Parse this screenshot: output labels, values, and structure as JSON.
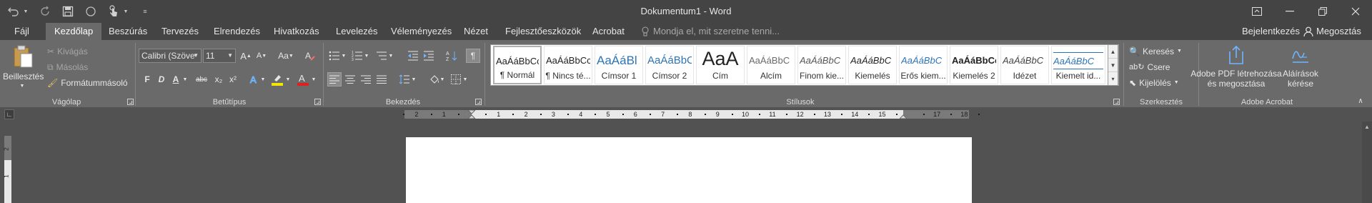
{
  "window": {
    "title": "Dokumentum1 - Word"
  },
  "quick_access": {
    "undo_icon": "undo-icon",
    "redo_icon": "redo-icon",
    "save_icon": "save-icon",
    "circle_icon": "circle-icon",
    "touch_icon": "touch-mode-icon",
    "customize_icon": "customize-qat-icon"
  },
  "tabs": [
    {
      "label": "Fájl"
    },
    {
      "label": "Kezdőlap"
    },
    {
      "label": "Beszúrás"
    },
    {
      "label": "Tervezés"
    },
    {
      "label": "Elrendezés"
    },
    {
      "label": "Hivatkozás"
    },
    {
      "label": "Levelezés"
    },
    {
      "label": "Véleményezés"
    },
    {
      "label": "Nézet"
    },
    {
      "label": "Fejlesztőeszközök"
    },
    {
      "label": "Acrobat"
    }
  ],
  "tell_me": "Mondja el, mit szeretne tenni...",
  "account": {
    "signin": "Bejelentkezés",
    "share": "Megosztás"
  },
  "clipboard": {
    "paste": "Beillesztés",
    "cut": "Kivágás",
    "copy": "Másolás",
    "format_painter": "Formátummásoló",
    "group": "Vágólap"
  },
  "font": {
    "name": "Calibri (Szöve",
    "size": "11",
    "group": "Betűtípus",
    "grow": "A",
    "shrink": "A",
    "case": "Aa",
    "bold": "F",
    "italic": "D",
    "underline": "A",
    "strike": "abc",
    "subscript": "x₂",
    "superscript": "x²",
    "highlight_color": "#f2e600",
    "font_color": "#e02020"
  },
  "paragraph": {
    "group": "Bekezdés"
  },
  "styles": {
    "group": "Stílusok",
    "items": [
      {
        "sample": "AaÁáBbCc",
        "name": "¶ Normál"
      },
      {
        "sample": "AaÁáBbCc",
        "name": "¶ Nincs té..."
      },
      {
        "sample": "AaÁáBl",
        "name": "Címsor 1"
      },
      {
        "sample": "AaÁáBbC",
        "name": "Címsor 2"
      },
      {
        "sample": "AaA",
        "name": "Cím"
      },
      {
        "sample": "AaÁáBbC",
        "name": "Alcím"
      },
      {
        "sample": "AaÁáBbC",
        "name": "Finom kie..."
      },
      {
        "sample": "AaÁáBbC",
        "name": "Kiemelés"
      },
      {
        "sample": "AaÁáBbC",
        "name": "Erős kiem..."
      },
      {
        "sample": "AaÁáBbCc",
        "name": "Kiemelés 2"
      },
      {
        "sample": "AaÁáBbC",
        "name": "Idézet"
      },
      {
        "sample": "AaÁáBbC",
        "name": "Kiemelt id..."
      }
    ]
  },
  "editing": {
    "find": "Keresés",
    "replace": "Csere",
    "select": "Kijelölés",
    "group": "Szerkesztés"
  },
  "acrobat": {
    "create_pdf_line1": "Adobe PDF létrehozása",
    "create_pdf_line2": "és megosztása",
    "sign_line1": "Aláírások",
    "sign_line2": "kérése",
    "group": "Adobe Acrobat"
  },
  "ruler": {
    "numbers": [
      "2",
      "1",
      "1",
      "2",
      "3",
      "4",
      "5",
      "6",
      "7",
      "8",
      "9",
      "10",
      "11",
      "12",
      "13",
      "14",
      "15",
      "17",
      "18"
    ]
  },
  "vruler": {
    "numbers": [
      "2",
      "1"
    ]
  }
}
